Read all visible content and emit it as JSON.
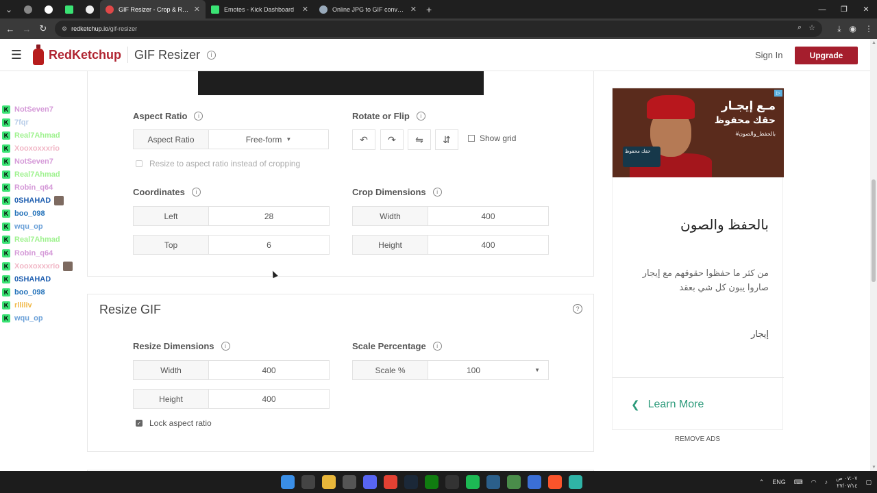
{
  "browser": {
    "tabs": [
      {
        "title": "GIF Resizer - Crop & Resize Animated GIFs",
        "active": true
      },
      {
        "title": "Emotes - Kick Dashboard",
        "active": false
      },
      {
        "title": "Online JPG to GIF converter",
        "active": false
      }
    ],
    "url_host": "redketchup.io",
    "url_path": "/gif-resizer"
  },
  "header": {
    "logo_text": "RedKetchup",
    "page_title": "GIF Resizer",
    "sign_in": "Sign In",
    "upgrade": "Upgrade"
  },
  "chat": [
    {
      "name": "NotSeven7",
      "color": "#d59ad8"
    },
    {
      "name": "7fqr",
      "color": "#b8cde8"
    },
    {
      "name": "Real7Ahmad",
      "color": "#9ef28e"
    },
    {
      "name": "Xooxoxxxrio",
      "color": "#f1b7c6"
    },
    {
      "name": "NotSeven7",
      "color": "#d59ad8"
    },
    {
      "name": "Real7Ahmad",
      "color": "#9ef28e"
    },
    {
      "name": "Robin_q64",
      "color": "#d59ad8"
    },
    {
      "name": "0SHAHAD",
      "color": "#1f5fb0",
      "avatar": true
    },
    {
      "name": "boo_098",
      "color": "#1f6fb8"
    },
    {
      "name": "wqu_op",
      "color": "#6aa0d8"
    },
    {
      "name": "Real7Ahmad",
      "color": "#9ef28e"
    },
    {
      "name": "Robin_q64",
      "color": "#d59ad8"
    },
    {
      "name": "Xooxoxxxrio",
      "color": "#f1b7c6",
      "avatar": true
    },
    {
      "name": "0SHAHAD",
      "color": "#1f5fb0"
    },
    {
      "name": "boo_098",
      "color": "#1f6fb8"
    },
    {
      "name": "rlliliv",
      "color": "#f0b94a"
    },
    {
      "name": "wqu_op",
      "color": "#6aa0d8"
    }
  ],
  "crop": {
    "aspect_ratio_label": "Aspect Ratio",
    "aspect_ratio_key": "Aspect Ratio",
    "aspect_ratio_value": "Free-form",
    "resize_to_ratio": "Resize to aspect ratio instead of cropping",
    "rotate_label": "Rotate or Flip",
    "show_grid": "Show grid",
    "coordinates_label": "Coordinates",
    "left_key": "Left",
    "left_value": "28",
    "top_key": "Top",
    "top_value": "6",
    "crop_dims_label": "Crop Dimensions",
    "width_key": "Width",
    "width_value": "400",
    "height_key": "Height",
    "height_value": "400"
  },
  "resize": {
    "section_title": "Resize GIF",
    "dims_label": "Resize Dimensions",
    "width_key": "Width",
    "width_value": "400",
    "height_key": "Height",
    "height_value": "400",
    "lock_aspect": "Lock aspect ratio",
    "scale_label": "Scale Percentage",
    "scale_key": "Scale %",
    "scale_value": "100"
  },
  "ad": {
    "img_line1": "مـع إيجـار",
    "img_line2": "حقك محفوظ",
    "img_line3": "#بالحفظ_والصون",
    "phone_text": "حقك محفوظ",
    "heading": "بالحفظ والصون",
    "body": "من كثر ما حفظوا حقوقهم مع إيجار صاروا يبون كل شي بعقد",
    "brand": "إيجار",
    "learn_more": "Learn More",
    "remove_ads": "REMOVE ADS"
  },
  "taskbar": {
    "lang": "ENG",
    "time": "٠٧:٠٧ ص",
    "date": "٢٧/٠٧/١٤"
  }
}
